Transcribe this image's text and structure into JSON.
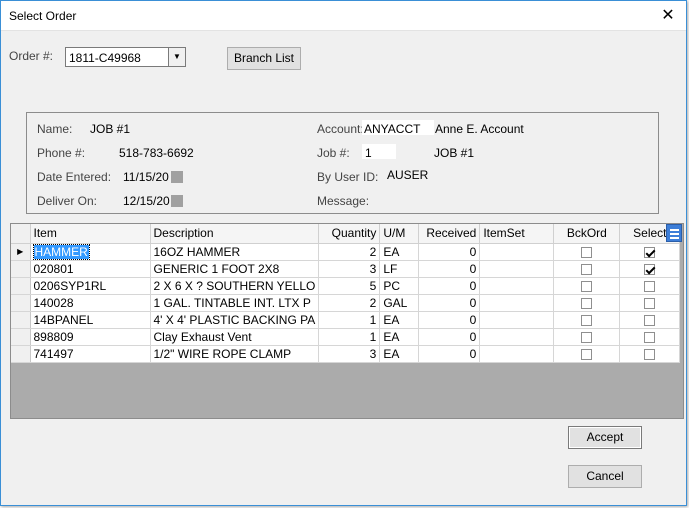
{
  "window": {
    "title": "Select Order",
    "close_glyph": "✕"
  },
  "order": {
    "label": "Order #:",
    "value": "1811-C49968",
    "dropdown_glyph": "▼"
  },
  "branch_button": "Branch List",
  "info": {
    "name_label": "Name:",
    "name_value": "JOB #1",
    "phone_label": "Phone #:",
    "phone_value": "518-783-6692",
    "date_entered_label": "Date Entered:",
    "date_entered_value": "11/15/20",
    "deliver_on_label": "Deliver On:",
    "deliver_on_value": "12/15/20",
    "account_label": "Account:",
    "account_value": "ANYACCT",
    "account_name": "Anne E. Account",
    "job_label": "Job #:",
    "job_value": "1",
    "job_name": "JOB #1",
    "user_label": "By User ID:",
    "user_value": "AUSER",
    "message_label": "Message:"
  },
  "grid": {
    "row_indicator_glyph": "▶",
    "columns": [
      "Item",
      "Description",
      "Quantity",
      "U/M",
      "Received",
      "ItemSet",
      "BckOrd",
      "Select"
    ],
    "rows": [
      {
        "item": "HAMMER",
        "description": "16OZ HAMMER",
        "quantity": "2",
        "um": "EA",
        "received": "0",
        "itemset": "",
        "bckord": false,
        "select": true
      },
      {
        "item": "020801",
        "description": "GENERIC 1 FOOT 2X8",
        "quantity": "3",
        "um": "LF",
        "received": "0",
        "itemset": "",
        "bckord": false,
        "select": true
      },
      {
        "item": "0206SYP1RL",
        "description": "2 X 6 X ? SOUTHERN YELLO",
        "quantity": "5",
        "um": "PC",
        "received": "0",
        "itemset": "",
        "bckord": false,
        "select": false
      },
      {
        "item": "140028",
        "description": "1 GAL. TINTABLE INT. LTX P",
        "quantity": "2",
        "um": "GAL",
        "received": "0",
        "itemset": "",
        "bckord": false,
        "select": false
      },
      {
        "item": "14BPANEL",
        "description": "4' X 4' PLASTIC BACKING PA",
        "quantity": "1",
        "um": "EA",
        "received": "0",
        "itemset": "",
        "bckord": false,
        "select": false
      },
      {
        "item": "898809",
        "description": "Clay Exhaust Vent",
        "quantity": "1",
        "um": "EA",
        "received": "0",
        "itemset": "",
        "bckord": false,
        "select": false
      },
      {
        "item": "741497",
        "description": "1/2\" WIRE ROPE CLAMP",
        "quantity": "3",
        "um": "EA",
        "received": "0",
        "itemset": "",
        "bckord": false,
        "select": false
      }
    ]
  },
  "buttons": {
    "accept": "Accept",
    "cancel": "Cancel"
  },
  "colors": {
    "accent": "#3399ff",
    "window_border": "#3a8fd6",
    "grid_menu": "#3d7ed8"
  }
}
